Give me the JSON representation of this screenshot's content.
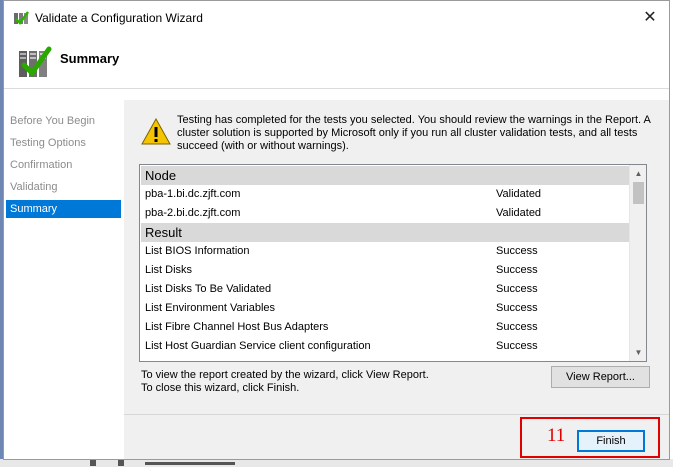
{
  "window": {
    "title": "Validate a Configuration Wizard",
    "close_glyph": "✕"
  },
  "header": {
    "title": "Summary"
  },
  "sidebar": {
    "items": [
      {
        "label": "Before You Begin",
        "active": false
      },
      {
        "label": "Testing Options",
        "active": false
      },
      {
        "label": "Confirmation",
        "active": false
      },
      {
        "label": "Validating",
        "active": false
      },
      {
        "label": "Summary",
        "active": true
      }
    ]
  },
  "message": {
    "text": "Testing has completed for the tests you selected. You should review the warnings in the Report.  A cluster solution is supported by Microsoft only if you run all cluster validation tests, and all tests succeed (with or without warnings)."
  },
  "report": {
    "node_header": "Node",
    "nodes": [
      {
        "name": "pba-1.bi.dc.zjft.com",
        "status": "Validated"
      },
      {
        "name": "pba-2.bi.dc.zjft.com",
        "status": "Validated"
      }
    ],
    "result_header": "Result",
    "results": [
      {
        "name": "List BIOS Information",
        "status": "Success"
      },
      {
        "name": "List Disks",
        "status": "Success"
      },
      {
        "name": "List Disks To Be Validated",
        "status": "Success"
      },
      {
        "name": "List Environment Variables",
        "status": "Success"
      },
      {
        "name": "List Fibre Channel Host Bus Adapters",
        "status": "Success"
      },
      {
        "name": "List Host Guardian Service client configuration",
        "status": "Success"
      }
    ]
  },
  "footnote": {
    "line1": "To view the report created by the wizard, click View Report.",
    "line2": "To close this wizard, click Finish."
  },
  "buttons": {
    "view_report": "View Report...",
    "finish": "Finish"
  },
  "annotation": {
    "number": "11"
  },
  "colors": {
    "accent": "#0078d7",
    "annotation": "#e00000",
    "warning": "#f5c400"
  }
}
